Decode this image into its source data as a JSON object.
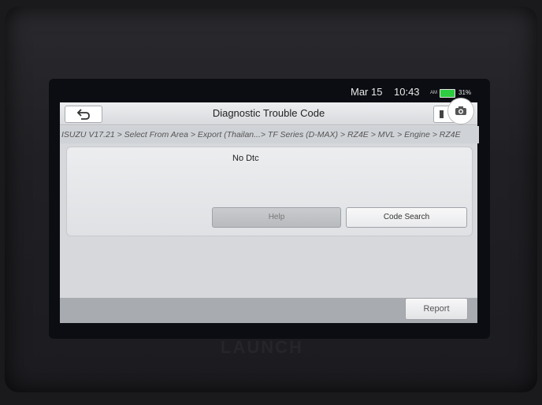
{
  "status": {
    "date": "Mar 15",
    "time": "10:43",
    "ampm": "AM",
    "battery": "31%"
  },
  "header": {
    "title": "Diagnostic Trouble Code",
    "breadcrumb": "ISUZU V17.21 > Select From Area > Export (Thailan...> TF Series (D-MAX) > RZ4E > MVL > Engine > RZ4E"
  },
  "panel": {
    "message": "No Dtc",
    "help_label": "Help",
    "code_search_label": "Code Search"
  },
  "footer": {
    "report_label": "Report"
  },
  "device": {
    "brand": "LAUNCH"
  },
  "colors": {
    "battery": "#2ecc40",
    "titlebar": "#e3e5e8",
    "bottombar": "#a8abaf"
  },
  "icons": [
    "back-arrow-icon",
    "print-icon",
    "camera-icon",
    "battery-icon"
  ]
}
